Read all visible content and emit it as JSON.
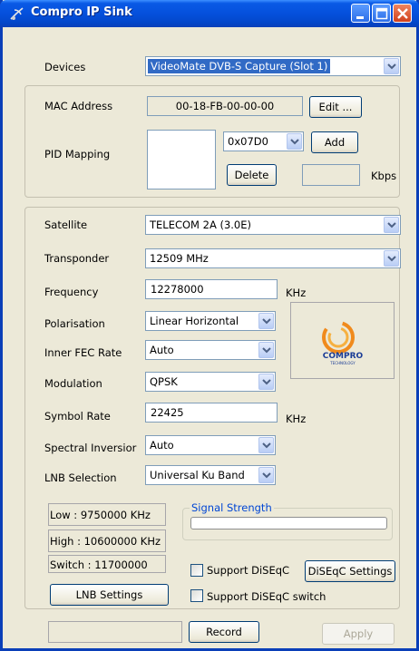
{
  "window": {
    "title": "Compro IP Sink"
  },
  "devices": {
    "label": "Devices",
    "selected": "VideoMate DVB-S Capture (Slot 1)"
  },
  "mac": {
    "label": "MAC Address",
    "value": "00-18-FB-00-00-00",
    "edit_button": "Edit ..."
  },
  "pid": {
    "label": "PID Mapping",
    "selected": "0x07D0",
    "add_button": "Add",
    "delete_button": "Delete",
    "rate_value": "",
    "rate_unit": "Kbps"
  },
  "tuner": {
    "satellite": {
      "label": "Satellite",
      "selected": "TELECOM 2A (3.0E)"
    },
    "transponder": {
      "label": "Transponder",
      "selected": "12509 MHz"
    },
    "frequency": {
      "label": "Frequency",
      "value": "12278000",
      "unit": "KHz"
    },
    "polarisation": {
      "label": "Polarisation",
      "selected": "Linear Horizontal"
    },
    "inner_fec": {
      "label": "Inner FEC Rate",
      "selected": "Auto"
    },
    "modulation": {
      "label": "Modulation",
      "selected": "QPSK"
    },
    "symbol_rate": {
      "label": "Symbol Rate",
      "value": "22425",
      "unit": "KHz"
    },
    "spectral": {
      "label": "Spectral Inversior",
      "selected": "Auto"
    },
    "lnb": {
      "label": "LNB Selection",
      "selected": "Universal Ku Band"
    }
  },
  "lnb_info": {
    "low": "Low : 9750000 KHz",
    "high": "High : 10600000 KHz",
    "switch": "Switch : 11700000",
    "settings_button": "LNB Settings"
  },
  "signal": {
    "label": "Signal Strength",
    "level": 0
  },
  "diseqc": {
    "support_label": "Support DiSEqC",
    "support_checked": false,
    "settings_button": "DiSEqC Settings",
    "switch_label": "Support DiSEqC switch",
    "switch_checked": false
  },
  "footer": {
    "status": "",
    "record_button": "Record",
    "apply_button": "Apply"
  },
  "logo": {
    "icon": "compro-technology-logo",
    "text": "COMPRO",
    "sub": "TECHNOLOGY"
  },
  "colors": {
    "titlebar": "#0550dc",
    "face": "#ece9d8",
    "selection": "#316ac5"
  }
}
